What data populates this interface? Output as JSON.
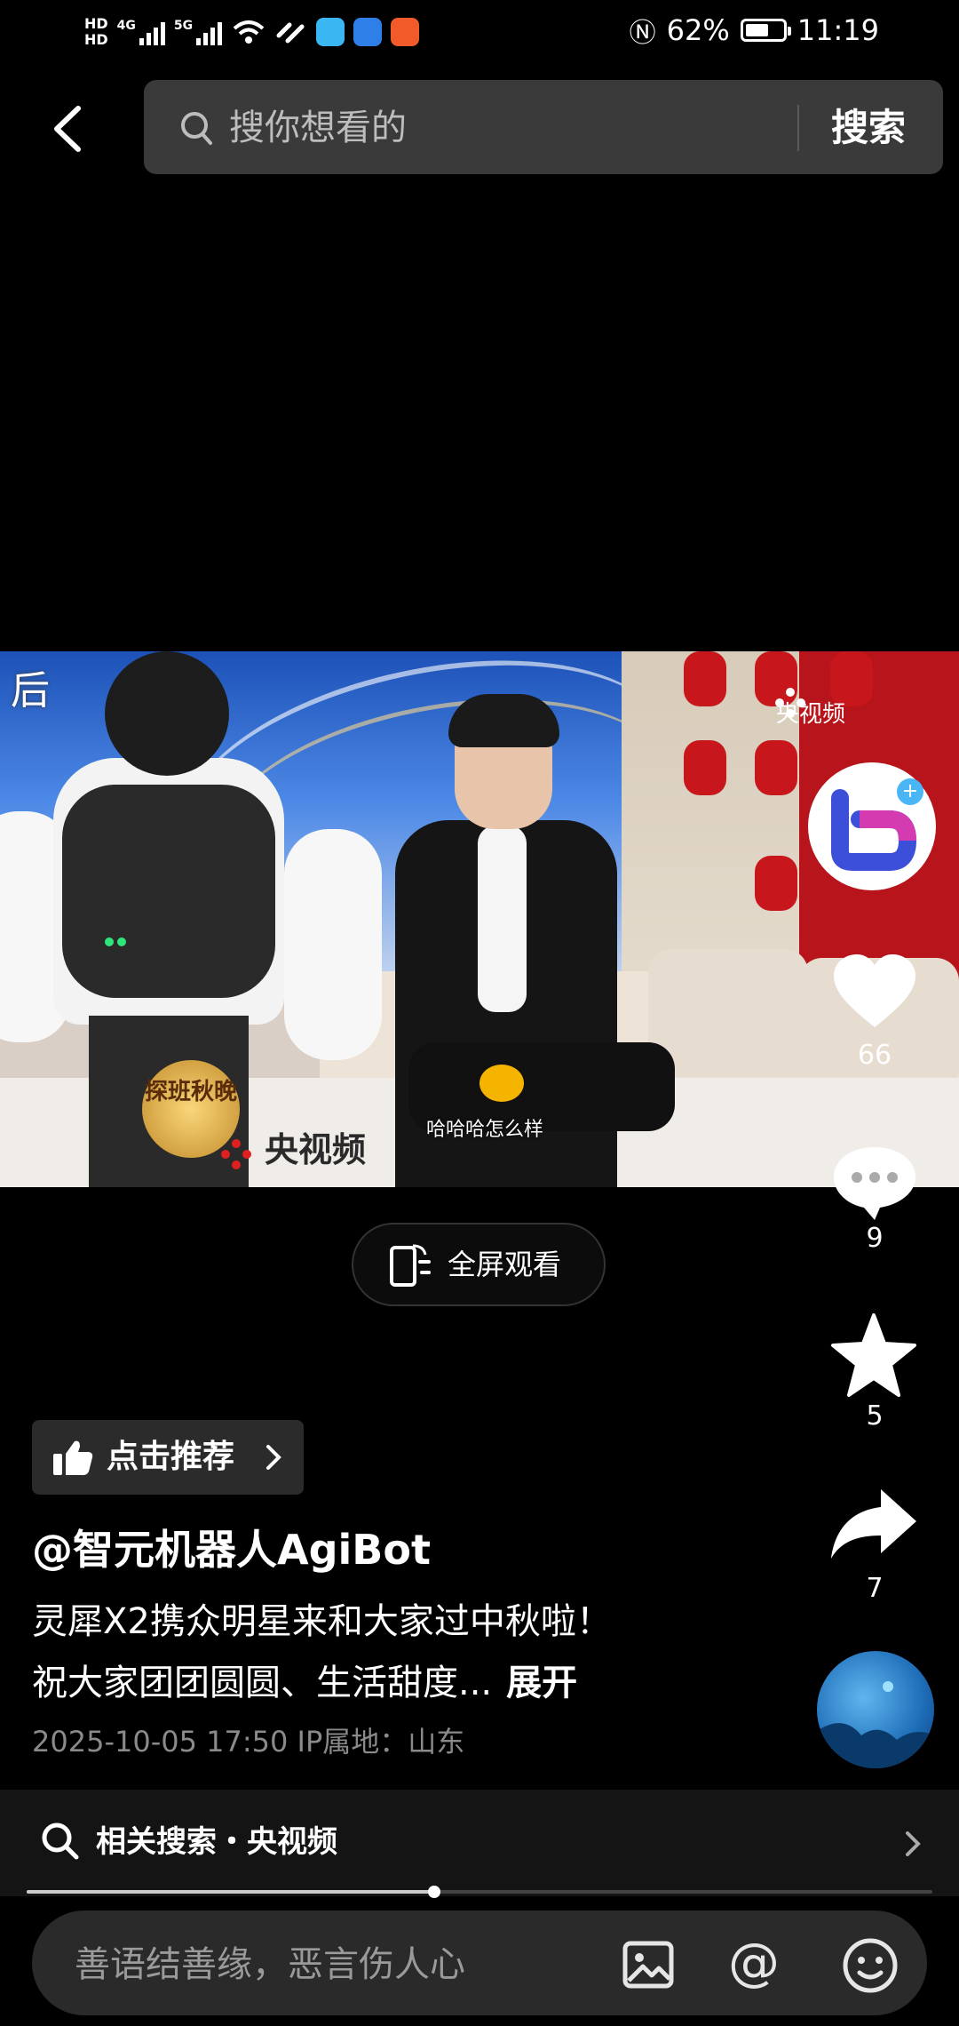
{
  "status_bar": {
    "hd1": "HD",
    "hd2": "HD",
    "net1": "4G",
    "net2": "5G",
    "battery_percent": "62%",
    "battery_level": 0.62,
    "time": "11:19"
  },
  "search": {
    "placeholder": "搜你想看的",
    "button": "搜索"
  },
  "video": {
    "corner_text": "后",
    "watermark_top": "央视频",
    "watermark_bottom": "央视频",
    "badge_text": "探班秋晚",
    "subtitle": "哈哈哈怎么样"
  },
  "fullscreen": {
    "label": "全屏观看"
  },
  "actions": {
    "likes": "66",
    "comments": "9",
    "favorites": "5",
    "shares": "7"
  },
  "post": {
    "recommend_label": "点击推荐",
    "author": "@智元机器人AgiBot",
    "desc_line1": "灵犀X2携众明星来和大家过中秋啦！",
    "desc_line2": "祝大家团团圆圆、生活甜度...",
    "expand": "展开",
    "meta": "2025-10-05 17:50  IP属地：山东"
  },
  "related_search": {
    "label": "相关搜索・央视频"
  },
  "playback_progress": 0.45,
  "comment_input": {
    "placeholder": "善语结善缘，恶言伤人心"
  },
  "colors": {
    "background": "#000000",
    "search_bg": "#3a3a3a",
    "accent_red": "#e02020"
  }
}
